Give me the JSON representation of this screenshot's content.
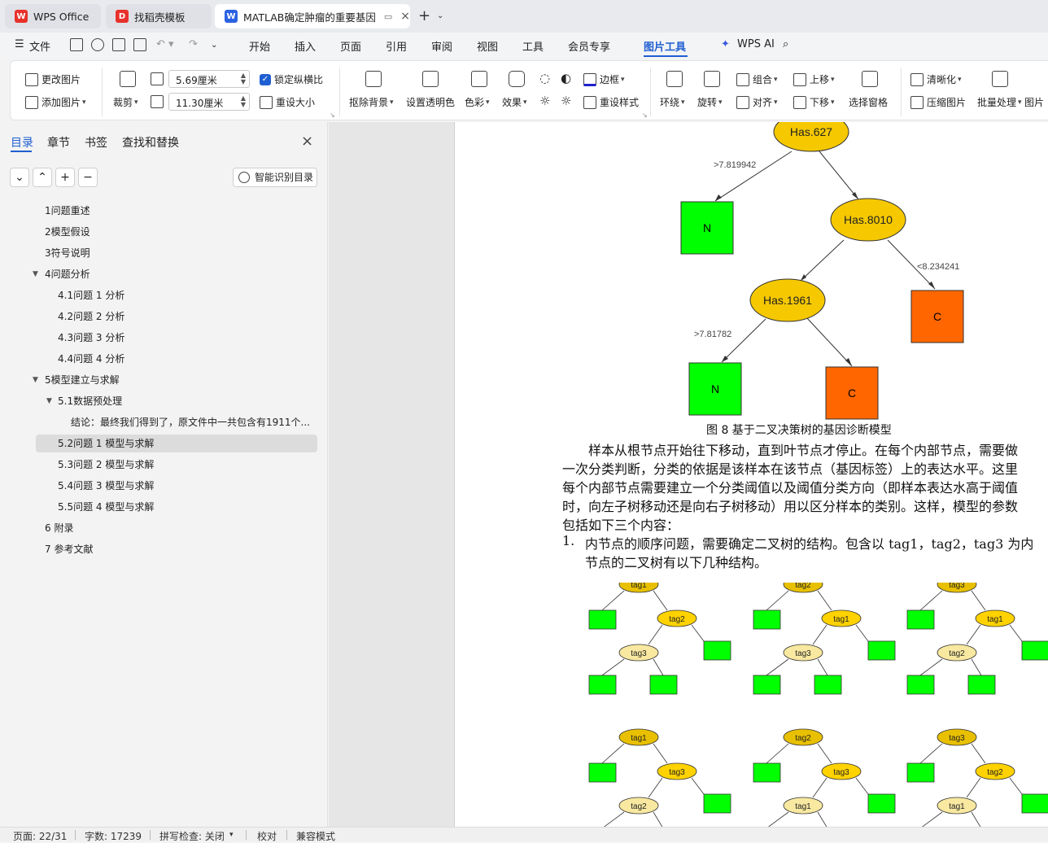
{
  "tabs": [
    {
      "label": "WPS Office"
    },
    {
      "label": "找稻壳模板"
    },
    {
      "label": "MATLAB确定肿瘤的重要基因"
    }
  ],
  "menu": {
    "file": "文件",
    "items": [
      "开始",
      "插入",
      "页面",
      "引用",
      "审阅",
      "视图",
      "工具",
      "会员专享",
      "图片工具"
    ],
    "wps_ai": "WPS AI"
  },
  "ribbon": {
    "change_picture": "更改图片",
    "add_picture": "添加图片",
    "crop": "裁剪",
    "height_value": "5.69厘米",
    "width_value": "11.30厘米",
    "lock_ratio": "锁定纵横比",
    "reset_size": "重设大小",
    "remove_bg": "抠除背景",
    "set_transparent": "设置透明色",
    "color": "色彩",
    "effects": "效果",
    "border": "边框",
    "reset_style": "重设样式",
    "wrap": "环绕",
    "rotate": "旋转",
    "group": "组合",
    "align": "对齐",
    "bring_forward": "上移",
    "send_backward": "下移",
    "selection_pane": "选择窗格",
    "sharpen": "清晰化",
    "compress": "压缩图片",
    "batch": "批量处理",
    "more": "图片"
  },
  "sidebar": {
    "tabs": [
      "目录",
      "章节",
      "书签",
      "查找和替换"
    ],
    "smart_toc": "智能识别目录",
    "toc": [
      {
        "label": "1问题重述"
      },
      {
        "label": "2模型假设"
      },
      {
        "label": "3符号说明"
      },
      {
        "label": "4问题分析"
      },
      {
        "label": "4.1问题 1 分析"
      },
      {
        "label": "4.2问题 2 分析"
      },
      {
        "label": "4.3问题 3 分析"
      },
      {
        "label": "4.4问题 4 分析"
      },
      {
        "label": "5模型建立与求解"
      },
      {
        "label": "5.1数据预处理"
      },
      {
        "label": "结论：最终我们得到了，原文件中一共包含有1911个..."
      },
      {
        "label": "5.2问题 1 模型与求解"
      },
      {
        "label": "5.3问题 2 模型与求解"
      },
      {
        "label": "5.4问题 3 模型与求解"
      },
      {
        "label": "5.5问题 4 模型与求解"
      },
      {
        "label": "6 附录"
      },
      {
        "label": "7 参考文献"
      }
    ]
  },
  "tree": {
    "root": "Has.627",
    "node2": "Has.8010",
    "node3": "Has.1961",
    "edge1": ">7.819942",
    "edge2": "<8.234241",
    "edge3": ">7.81782",
    "leaf_n": "N",
    "leaf_c": "C"
  },
  "doc": {
    "caption": "图 8   基于二叉决策树的基因诊断模型",
    "para_lines": [
      "样本从根节点开始往下移动，直到叶节点才停止。在每个内部节点，需要做",
      "一次分类判断，分类的依据是该样本在该节点（基因标签）上的表达水平。这里",
      "每个内部节点需要建立一个分类阈值以及阈值分类方向（即样本表达水高于阈值",
      "时，向左子树移动还是向右子树移动）用以区分样本的类别。这样，模型的参数",
      "包括如下三个内容："
    ],
    "item1_num": "1.",
    "item1_line1": "内节点的顺序问题，需要确定二叉树的结构。包含以 tag1，tag2，tag3 为内",
    "item1_line2": "节点的二叉树有以下几种结构。",
    "mini_trees": [
      [
        "tag1",
        "tag2",
        "tag3"
      ],
      [
        "tag2",
        "tag1",
        "tag3"
      ],
      [
        "tag3",
        "tag1",
        "tag2"
      ],
      [
        "tag1",
        "tag3",
        "tag2"
      ],
      [
        "tag2",
        "tag3",
        "tag1"
      ],
      [
        "tag3",
        "tag2",
        "tag1"
      ]
    ]
  },
  "status": {
    "page": "页面: 22/31",
    "words": "字数: 17239",
    "spell": "拼写检查: 关闭",
    "proof": "校对",
    "compat": "兼容模式"
  },
  "colors": {
    "accent": "#1f5fd1",
    "node_gold": "#f5c800",
    "leaf_green": "#00ff00",
    "leaf_orange": "#ff6600"
  }
}
